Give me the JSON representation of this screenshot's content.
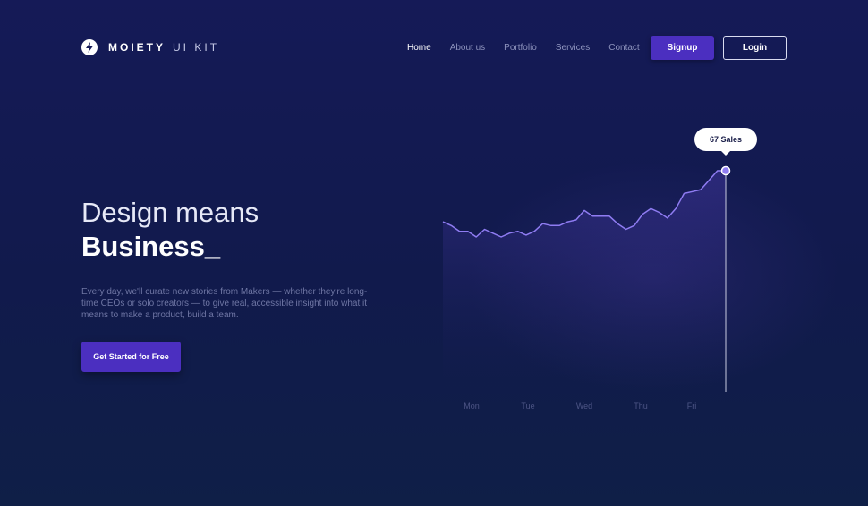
{
  "brand": {
    "name": "MOIETY",
    "sub": "UI KIT",
    "icon": "lightning-bolt-icon"
  },
  "nav": {
    "items": [
      {
        "label": "Home",
        "active": true
      },
      {
        "label": "About us",
        "active": false
      },
      {
        "label": "Portfolio",
        "active": false
      },
      {
        "label": "Services",
        "active": false
      },
      {
        "label": "Contact",
        "active": false
      }
    ],
    "signup_label": "Signup",
    "login_label": "Login"
  },
  "hero": {
    "title_line1": "Design means",
    "title_line2": "Business_",
    "description": "Every day, we'll curate new stories from Makers — whether they're long-time CEOs or solo creators — to give real, accessible insight into what it means to make a product, build a team.",
    "cta_label": "Get Started for Free"
  },
  "chart_tooltip": "67 Sales",
  "colors": {
    "accent": "#4b2fc0",
    "line": "#8f7cf2",
    "background": "#151a57"
  },
  "chart_data": {
    "type": "area",
    "categories": [
      "Mon",
      "Tue",
      "Wed",
      "Thu",
      "Fri"
    ],
    "x": [
      0,
      0.25,
      0.5,
      0.75,
      1,
      1.25,
      1.5,
      1.75,
      2,
      2.25,
      2.5,
      2.75,
      3,
      3.25,
      3.5,
      3.75,
      4,
      4.25,
      4.5,
      4.75,
      5,
      5.25,
      5.5,
      5.75,
      6,
      6.25,
      6.5,
      6.75,
      7,
      7.25,
      7.5,
      7.75,
      8,
      8.25,
      8.5,
      8.75,
      9,
      9.25,
      9.5,
      9.75,
      10
    ],
    "values": [
      40,
      38,
      35,
      35,
      32,
      36,
      34,
      32,
      34,
      35,
      33,
      35,
      39,
      38,
      38,
      40,
      41,
      46,
      43,
      43,
      43,
      39,
      36,
      38,
      44,
      47,
      45,
      42,
      47,
      55,
      56,
      57,
      62,
      67,
      67
    ],
    "highlight": {
      "label": "67 Sales",
      "value": 67,
      "index": 34
    }
  }
}
